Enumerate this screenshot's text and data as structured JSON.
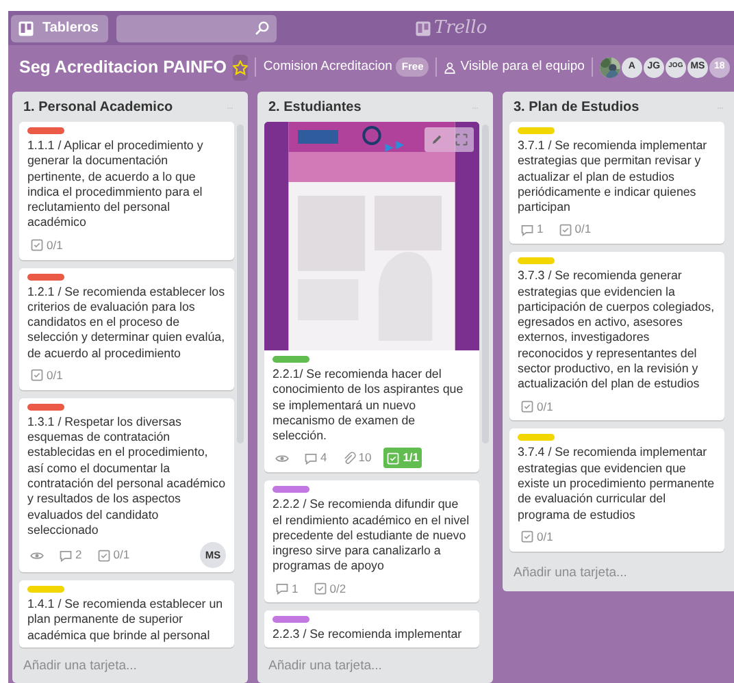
{
  "top_bar": {
    "boards_button": "Tableros",
    "logo": "Trello"
  },
  "board": {
    "title": "Seg Acreditacion PAINFO",
    "starred": true,
    "team": "Comision Acreditacion",
    "plan": "Free",
    "visibility": "Visible para el equipo",
    "members": [
      {
        "kind": "picture"
      },
      {
        "kind": "initials",
        "text": "A"
      },
      {
        "kind": "initials",
        "text": "JG"
      },
      {
        "kind": "initials",
        "text": "JOG"
      },
      {
        "kind": "initials",
        "text": "MS"
      },
      {
        "kind": "count",
        "text": "18"
      }
    ]
  },
  "lists": [
    {
      "title": "1. Personal Academico",
      "add_card": "Añadir una tarjeta...",
      "cards": [
        {
          "color": "#eb5a46",
          "text": "1.1.1 / Aplicar el procedimiento y generar la documentación pertinente, de acuerdo a lo que indica el procedimmiento para el reclutamiento del personal académico",
          "badges": [
            {
              "kind": "checklist",
              "text": "0/1",
              "complete": false
            }
          ]
        },
        {
          "color": "#eb5a46",
          "text": "1.2.1 / Se recomienda establecer los criterios de evaluación para los candidatos en el proceso de selección y determinar quien evalúa, de acuerdo al procedimiento",
          "badges": [
            {
              "kind": "checklist",
              "text": "0/1",
              "complete": false
            }
          ]
        },
        {
          "color": "#eb5a46",
          "text": "1.3.1 / Respetar los diversas esquemas de contratación establecidas en el procedimiento, así como el documentar la contratación del personal académico y resultados de los aspectos evaluados del candidato seleccionado",
          "badges": [
            {
              "kind": "watch"
            },
            {
              "kind": "comments",
              "text": "2"
            },
            {
              "kind": "checklist",
              "text": "0/1",
              "complete": false
            }
          ],
          "members": [
            "MS"
          ]
        },
        {
          "color": "#f2d600",
          "text": "1.4.1 / Se recomienda establecer un plan permanente de superior académica que brinde al personal"
        }
      ]
    },
    {
      "title": "2. Estudiantes",
      "add_card": "Añadir una tarjeta...",
      "cards": [
        {
          "cover": {
            "kind": "picture"
          },
          "color": "#61bd4f",
          "text": "2.2.1/ Se recomienda hacer del conocimiento de los aspirantes que se implementará un nuevo mecanismo de examen de selección.",
          "badges": [
            {
              "kind": "watch"
            },
            {
              "kind": "comments",
              "text": "4"
            },
            {
              "kind": "attachments",
              "text": "10"
            },
            {
              "kind": "checklist",
              "text": "1/1",
              "complete": true
            }
          ]
        },
        {
          "color": "#c377e0",
          "text": "2.2.2 / Se recomienda difundir que el rendimiento académico en el nivel precedente del estudiante de nuevo ingreso sirve para canalizarlo a programas de apoyo",
          "badges": [
            {
              "kind": "comments",
              "text": "1"
            },
            {
              "kind": "checklist",
              "text": "0/2",
              "complete": false
            }
          ]
        },
        {
          "color": "#c377e0",
          "text": "2.2.3 / Se recomienda implementar"
        }
      ]
    },
    {
      "title": "3. Plan de Estudios",
      "add_card": "Añadir una tarjeta...",
      "cards": [
        {
          "color": "#f2d600",
          "text": "3.7.1 / Se recomienda implementar estrategias que permitan revisar y actualizar el plan de estudios periódicamente e indicar quienes participan",
          "badges": [
            {
              "kind": "comments",
              "text": "1"
            },
            {
              "kind": "checklist",
              "text": "0/1",
              "complete": false
            }
          ]
        },
        {
          "color": "#f2d600",
          "text": "3.7.3 / Se recomienda generar estrategias que evidencien la participación de cuerpos colegiados, egresados en activo, asesores externos, investigadores reconocidos y representantes del sector productivo, en la revisión y actualización del plan de estudios",
          "badges": [
            {
              "kind": "checklist",
              "text": "0/1",
              "complete": false
            }
          ]
        },
        {
          "color": "#f2d600",
          "text": "3.7.4 / Se recomienda implementar estrategias que evidencien que existe un procedimiento permanente de evaluación curricular del programa de estudios",
          "badges": [
            {
              "kind": "checklist",
              "text": "0/1",
              "complete": false
            }
          ]
        }
      ]
    }
  ]
}
